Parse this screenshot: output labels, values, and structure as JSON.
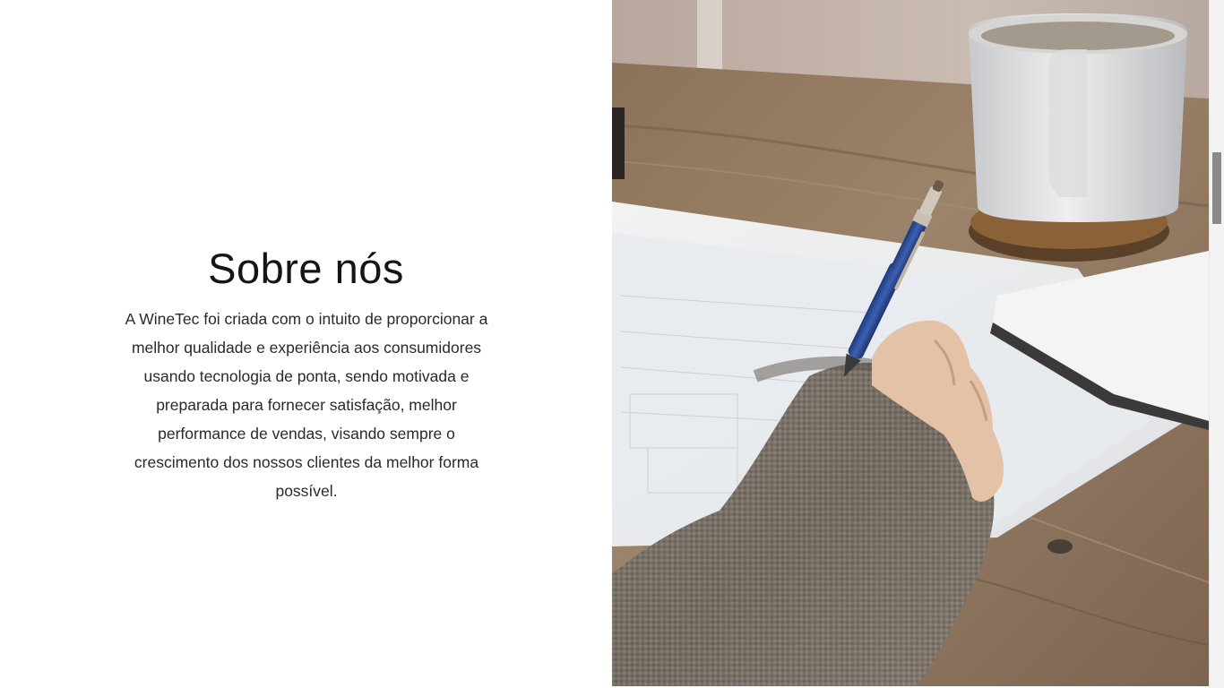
{
  "about": {
    "title": "Sobre nós",
    "lines": [
      "A WineTec foi criada com o intuito de proporcionar a",
      "melhor qualidade e experiência aos consumidores",
      "usando tecnologia de ponta, sendo motivada e",
      "preparada para fornecer satisfação, melhor",
      "performance de vendas, visando sempre o",
      "crescimento dos nossos clientes da melhor forma",
      "possível."
    ]
  },
  "colors": {
    "background": "#ffffff",
    "text": "#2a2a2a",
    "title": "#151515",
    "pen": "#2f4f9a"
  },
  "photo": {
    "icon": "photo-writing-desk"
  },
  "scrollbar": {
    "position_fraction": 0.22
  }
}
